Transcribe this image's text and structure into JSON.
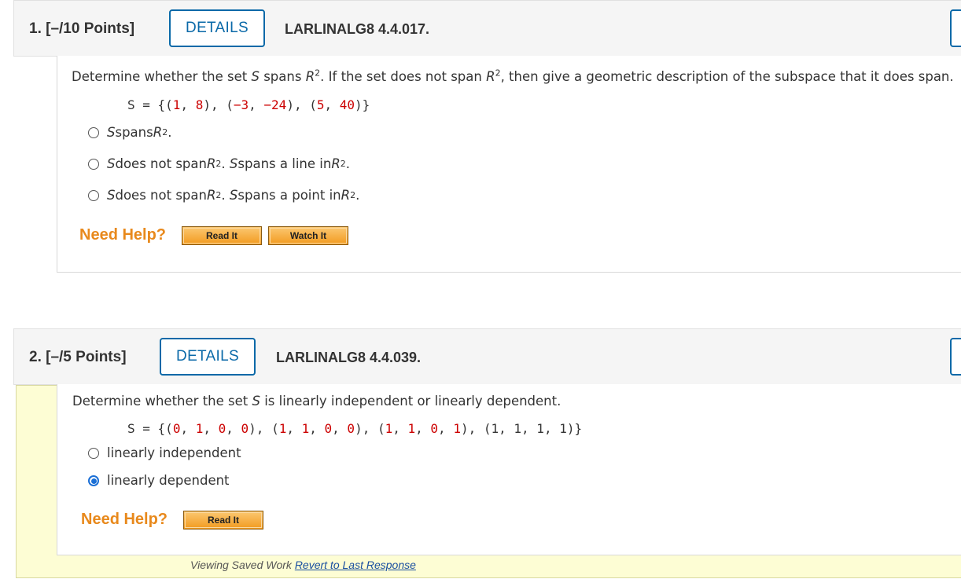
{
  "questions": [
    {
      "number_label": "1. [–/10 Points]",
      "details_label": "DETAILS",
      "code": "LARLINALG8 4.4.017.",
      "prompt": {
        "p1": "Determine whether the set ",
        "s": "S",
        "p2": " spans ",
        "r": "R",
        "exp": "2",
        "p3": ". If the set does not span ",
        "p4": ", then give a geometric description of the subspace that it does span."
      },
      "set": {
        "prefix": "S = {(",
        "parts": [
          "1",
          "8",
          "−3",
          "−24",
          "5",
          "40"
        ]
      },
      "options": [
        {
          "s": "S",
          "t1": " spans ",
          "r": "R",
          "exp": "2",
          "t2": ".",
          "selected": false
        },
        {
          "s": "S",
          "t1": " does not span ",
          "r": "R",
          "exp": "2",
          "t2": ". ",
          "s2": "S",
          "t3": " spans a line in ",
          "r2": "R",
          "exp2": "2",
          "t4": ".",
          "selected": false
        },
        {
          "s": "S",
          "t1": " does not span ",
          "r": "R",
          "exp": "2",
          "t2": ". ",
          "s2": "S",
          "t3": " spans a point in ",
          "r2": "R",
          "exp2": "2",
          "t4": ".",
          "selected": false
        }
      ],
      "need_help": "Need Help?",
      "help_buttons": [
        "Read It",
        "Watch It"
      ]
    },
    {
      "number_label": "2. [–/5 Points]",
      "details_label": "DETAILS",
      "code": "LARLINALG8 4.4.039.",
      "prompt": {
        "p1": "Determine whether the set ",
        "s": "S",
        "p2": " is linearly independent or linearly dependent."
      },
      "set": {
        "prefix": "S = {",
        "vectors": [
          [
            "0",
            "1",
            "0",
            "0"
          ],
          [
            "1",
            "1",
            "0",
            "0"
          ],
          [
            "1",
            "1",
            "0",
            "1"
          ],
          [
            "1",
            "1",
            "1",
            "1"
          ]
        ]
      },
      "options": [
        {
          "label": "linearly independent",
          "selected": false
        },
        {
          "label": "linearly dependent",
          "selected": true
        }
      ],
      "need_help": "Need Help?",
      "help_buttons": [
        "Read It"
      ]
    }
  ],
  "saved_work": {
    "text": "Viewing Saved Work ",
    "link": "Revert to Last Response"
  },
  "colors": {
    "accent": "#0a69a8",
    "red_value": "#cc0000",
    "need_help": "#e8891c",
    "saved_bg": "#fdfdd4"
  }
}
